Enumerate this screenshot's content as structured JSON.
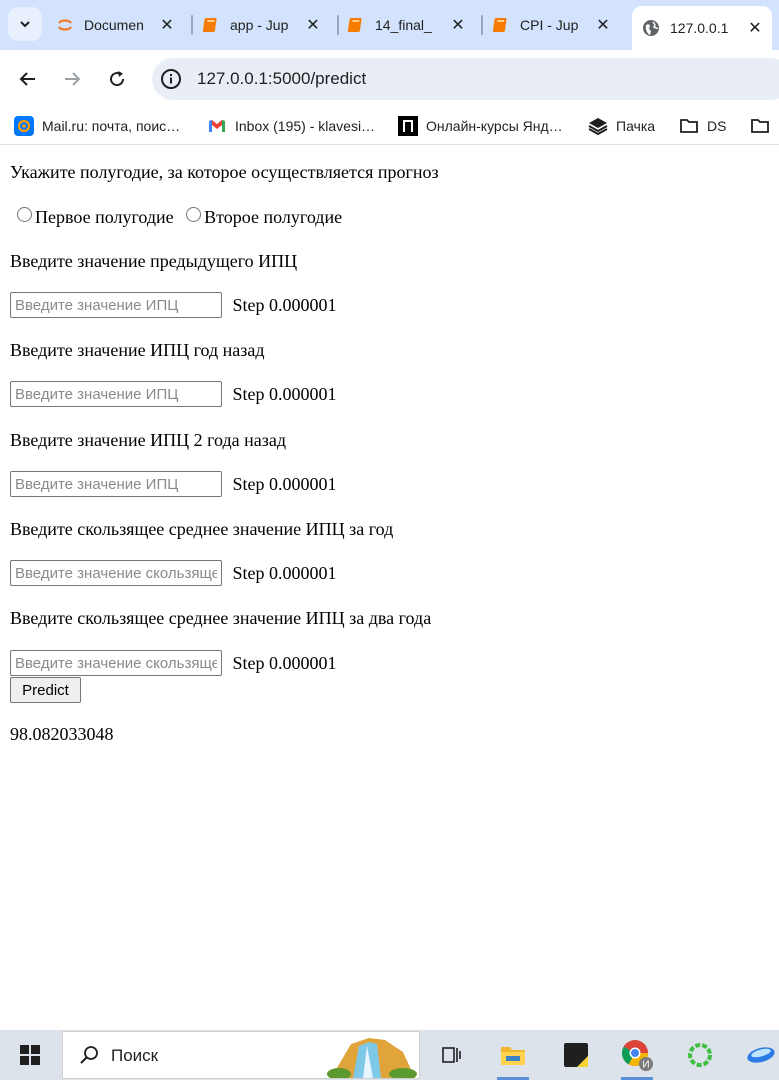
{
  "browser": {
    "tabs": [
      {
        "title": "Documen",
        "icon": "jupyter-icon"
      },
      {
        "title": "app - Jup",
        "icon": "notebook-icon"
      },
      {
        "title": "14_final_",
        "icon": "notebook-icon"
      },
      {
        "title": "CPI - Jup",
        "icon": "notebook-icon"
      },
      {
        "title": "127.0.0.1",
        "icon": "globe-icon"
      }
    ],
    "url": "127.0.0.1:5000/predict",
    "bookmarks": [
      {
        "label": "Mail.ru: почта, поис…",
        "icon": "mailru-icon"
      },
      {
        "label": "Inbox (195) - klavesi…",
        "icon": "gmail-icon"
      },
      {
        "label": "Онлайн-курсы Янд…",
        "icon": "yandex-practicum-icon"
      },
      {
        "label": "Пачка",
        "icon": "pachka-icon"
      },
      {
        "label": "DS",
        "icon": "folder-icon"
      }
    ]
  },
  "form": {
    "semester_prompt": "Укажите полугодие, за которое осуществляется прогноз",
    "semester_options": [
      "Первое полугодие",
      "Второе полугодие"
    ],
    "fields": [
      {
        "label": "Введите значение предыдущего ИПЦ",
        "placeholder": "Введите значение ИПЦ",
        "step_text": "Step 0.000001"
      },
      {
        "label": "Введите значение ИПЦ год назад",
        "placeholder": "Введите значение ИПЦ",
        "step_text": "Step 0.000001"
      },
      {
        "label": "Введите значение ИПЦ 2 года назад",
        "placeholder": "Введите значение ИПЦ",
        "step_text": "Step 0.000001"
      },
      {
        "label": "Введите скользящее среднее значение ИПЦ за год",
        "placeholder": "Введите значение скользящего среднего",
        "step_text": "Step 0.000001"
      },
      {
        "label": "Введите скользящее среднее значение ИПЦ за два года",
        "placeholder": "Введите значение скользящего среднего",
        "step_text": "Step 0.000001"
      }
    ],
    "submit_label": "Predict",
    "result": "98.082033048"
  },
  "taskbar": {
    "search_label": "Поиск"
  },
  "colors": {
    "tabstrip": "#d3e3fd",
    "omnibox": "#e9eef6",
    "taskbar": "#dde3ea"
  }
}
